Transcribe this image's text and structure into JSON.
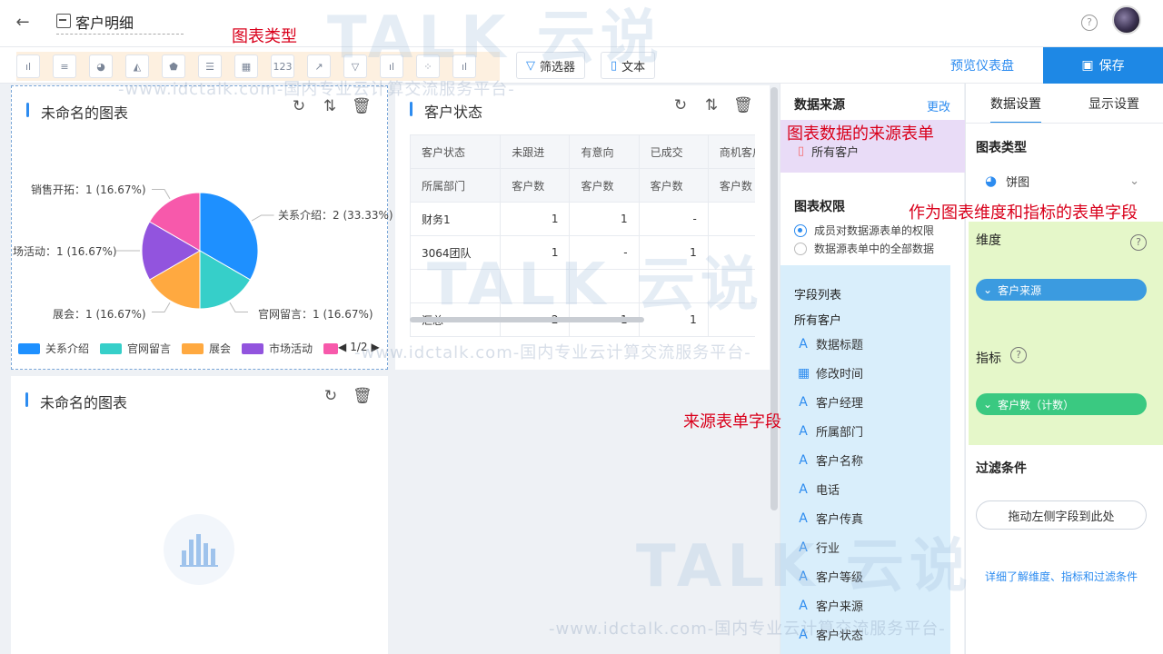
{
  "header": {
    "title": "客户明细"
  },
  "toolbar": {
    "chart_type_buttons": [
      "ıl",
      "≡",
      "◕",
      "◭",
      "⬟",
      "☰",
      "▦",
      "123",
      "↗",
      "▽",
      "ıl",
      "⁘",
      "ıl"
    ],
    "filter_label": "筛选器",
    "text_label": "文本",
    "preview_label": "预览仪表盘",
    "save_label": "保存"
  },
  "annotations": {
    "chart_type": "图表类型",
    "source_form": "图表数据的来源表单",
    "dim_metric": "作为图表维度和指标的表单字段",
    "source_fields": "来源表单字段"
  },
  "watermark": {
    "url_text": "-www.idctalk.com-国内专业云计算交流服务平台-",
    "brand": "TALK 云说"
  },
  "pie_card": {
    "title": "未命名的图表",
    "labels": [
      "关系介绍：2 (33.33%)",
      "官网留言：1 (16.67%)",
      "展会：1 (16.67%)",
      "场活动：1 (16.67%)",
      "销售开拓：1 (16.67%)"
    ],
    "legend": [
      "关系介绍",
      "官网留言",
      "展会",
      "市场活动"
    ],
    "pager": "1/2"
  },
  "chart_data": {
    "type": "pie",
    "categories": [
      "关系介绍",
      "官网留言",
      "展会",
      "市场活动",
      "销售开拓"
    ],
    "values": [
      2,
      1,
      1,
      1,
      1
    ],
    "percents": [
      33.33,
      16.67,
      16.67,
      16.67,
      16.67
    ],
    "colors": [
      "#1e90ff",
      "#36cfc9",
      "#ffa940",
      "#9254de",
      "#f759ab"
    ],
    "title": "未命名的图表"
  },
  "table_card": {
    "title": "客户状态",
    "header1": [
      "客户状态",
      "未跟进",
      "有意向",
      "已成交",
      "商机客户"
    ],
    "header2": [
      "所属部门",
      "客户数",
      "客户数",
      "客户数",
      "客户数"
    ],
    "rows": [
      [
        "财务1",
        "1",
        "1",
        "-",
        ""
      ],
      [
        "3064团队",
        "1",
        "-",
        "1",
        ""
      ]
    ],
    "total": [
      "汇总",
      "2",
      "1",
      "1",
      ""
    ]
  },
  "empty_card": {
    "title": "未命名的图表"
  },
  "data_source": {
    "title": "数据来源",
    "change_link": "更改",
    "source_name": "所有客户",
    "perm_title": "图表权限",
    "perm_options": [
      "成员对数据源表单的权限",
      "数据源表单中的全部数据"
    ],
    "field_list_title": "字段列表",
    "form_name": "所有客户",
    "fields": [
      "数据标题",
      "修改时间",
      "客户经理",
      "所属部门",
      "客户名称",
      "电话",
      "客户传真",
      "行业",
      "客户等级",
      "客户来源",
      "客户状态"
    ]
  },
  "settings": {
    "tab_data": "数据设置",
    "tab_display": "显示设置",
    "chart_type_title": "图表类型",
    "chart_type_value": "饼图",
    "dimension_title": "维度",
    "dimension_value": "客户来源",
    "metric_title": "指标",
    "metric_value": "客户数（计数）",
    "filter_title": "过滤条件",
    "drop_hint": "拖动左侧字段到此处",
    "learn_link": "详细了解维度、指标和过滤条件"
  }
}
